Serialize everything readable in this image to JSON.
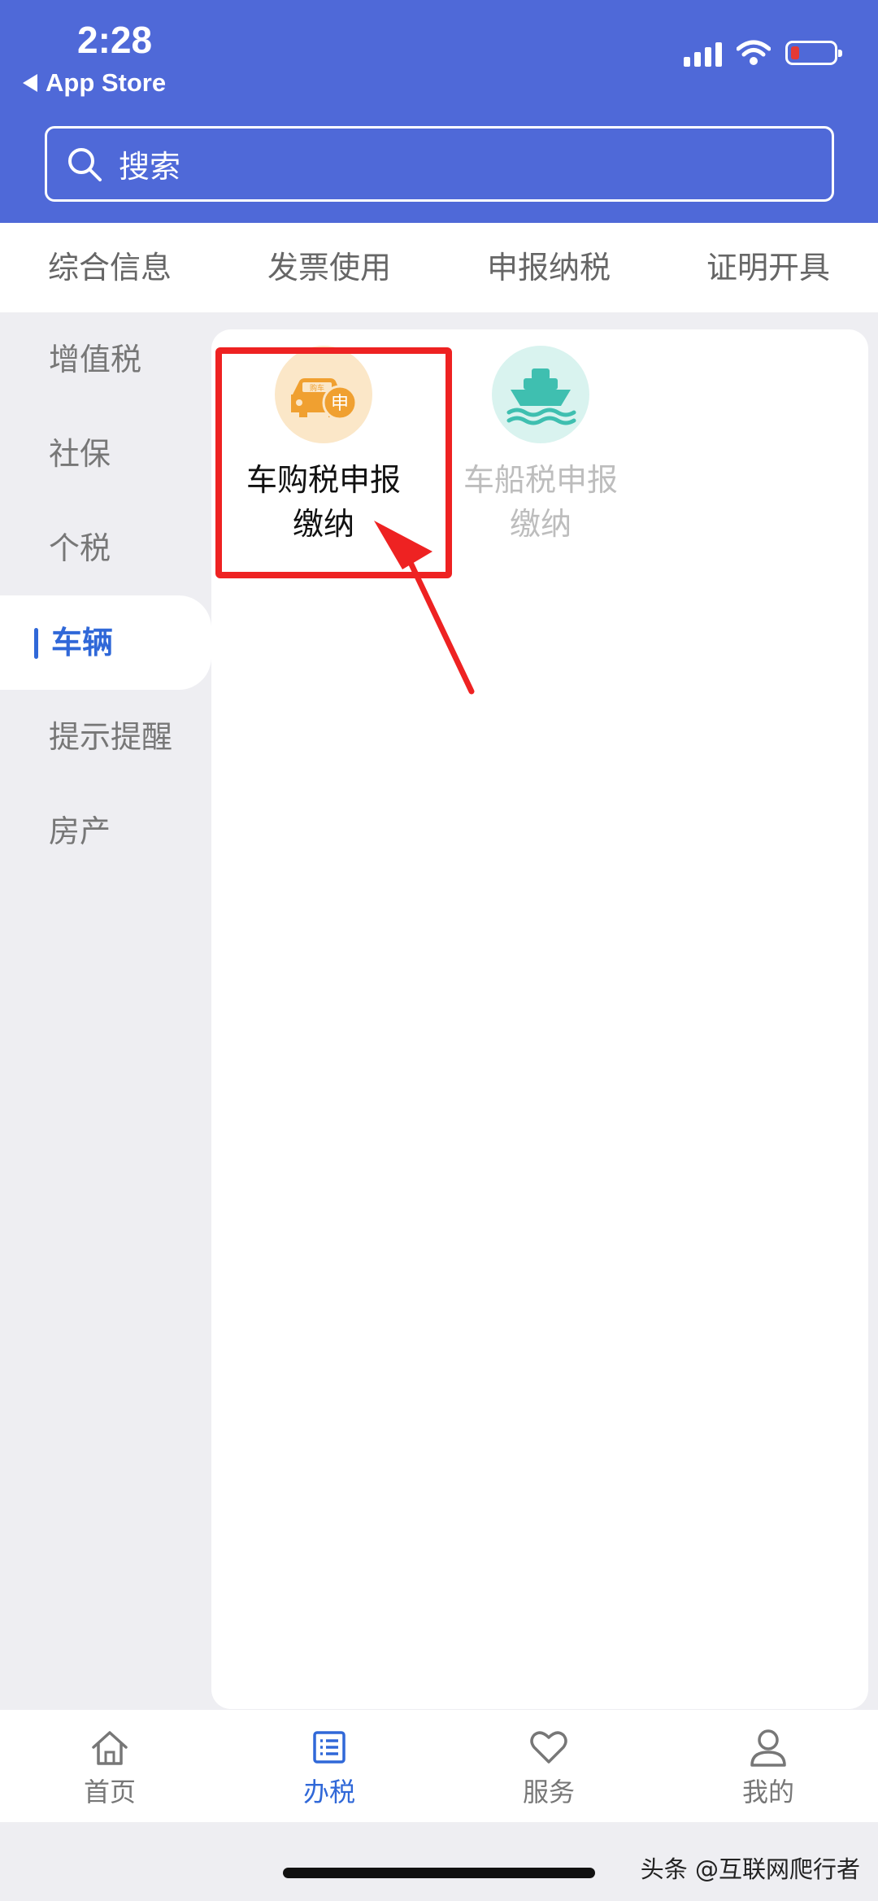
{
  "status_bar": {
    "time": "2:28",
    "back_label": "App Store"
  },
  "search": {
    "placeholder": "搜索"
  },
  "top_tabs": [
    "综合信息",
    "发票使用",
    "申报纳税",
    "证明开具"
  ],
  "sidebar": {
    "items": [
      "增值税",
      "社保",
      "个税",
      "车辆",
      "提示提醒",
      "房产"
    ],
    "active_index": 3
  },
  "services": [
    {
      "line1": "车购税申报",
      "line2": "缴纳",
      "icon": "car-purchase-tax-icon",
      "icon_badge": "申",
      "icon_tag": "购车",
      "highlighted": true
    },
    {
      "line1": "车船税申报",
      "line2": "缴纳",
      "icon": "ship-tax-icon",
      "highlighted": false
    }
  ],
  "bottom_nav": [
    {
      "label": "首页",
      "icon": "home-icon",
      "active": false
    },
    {
      "label": "办税",
      "icon": "list-icon",
      "active": true
    },
    {
      "label": "服务",
      "icon": "heart-icon",
      "active": false
    },
    {
      "label": "我的",
      "icon": "user-icon",
      "active": false
    }
  ],
  "watermark": "头条 @互联网爬行者",
  "colors": {
    "header": "#4f69d8",
    "accent": "#3068d8",
    "highlight": "#ee2222",
    "car_icon_bg": "#fbe7c8",
    "car_icon": "#f0a030",
    "ship_icon_bg": "#d9f3ef",
    "ship_icon": "#3fbfb0"
  }
}
